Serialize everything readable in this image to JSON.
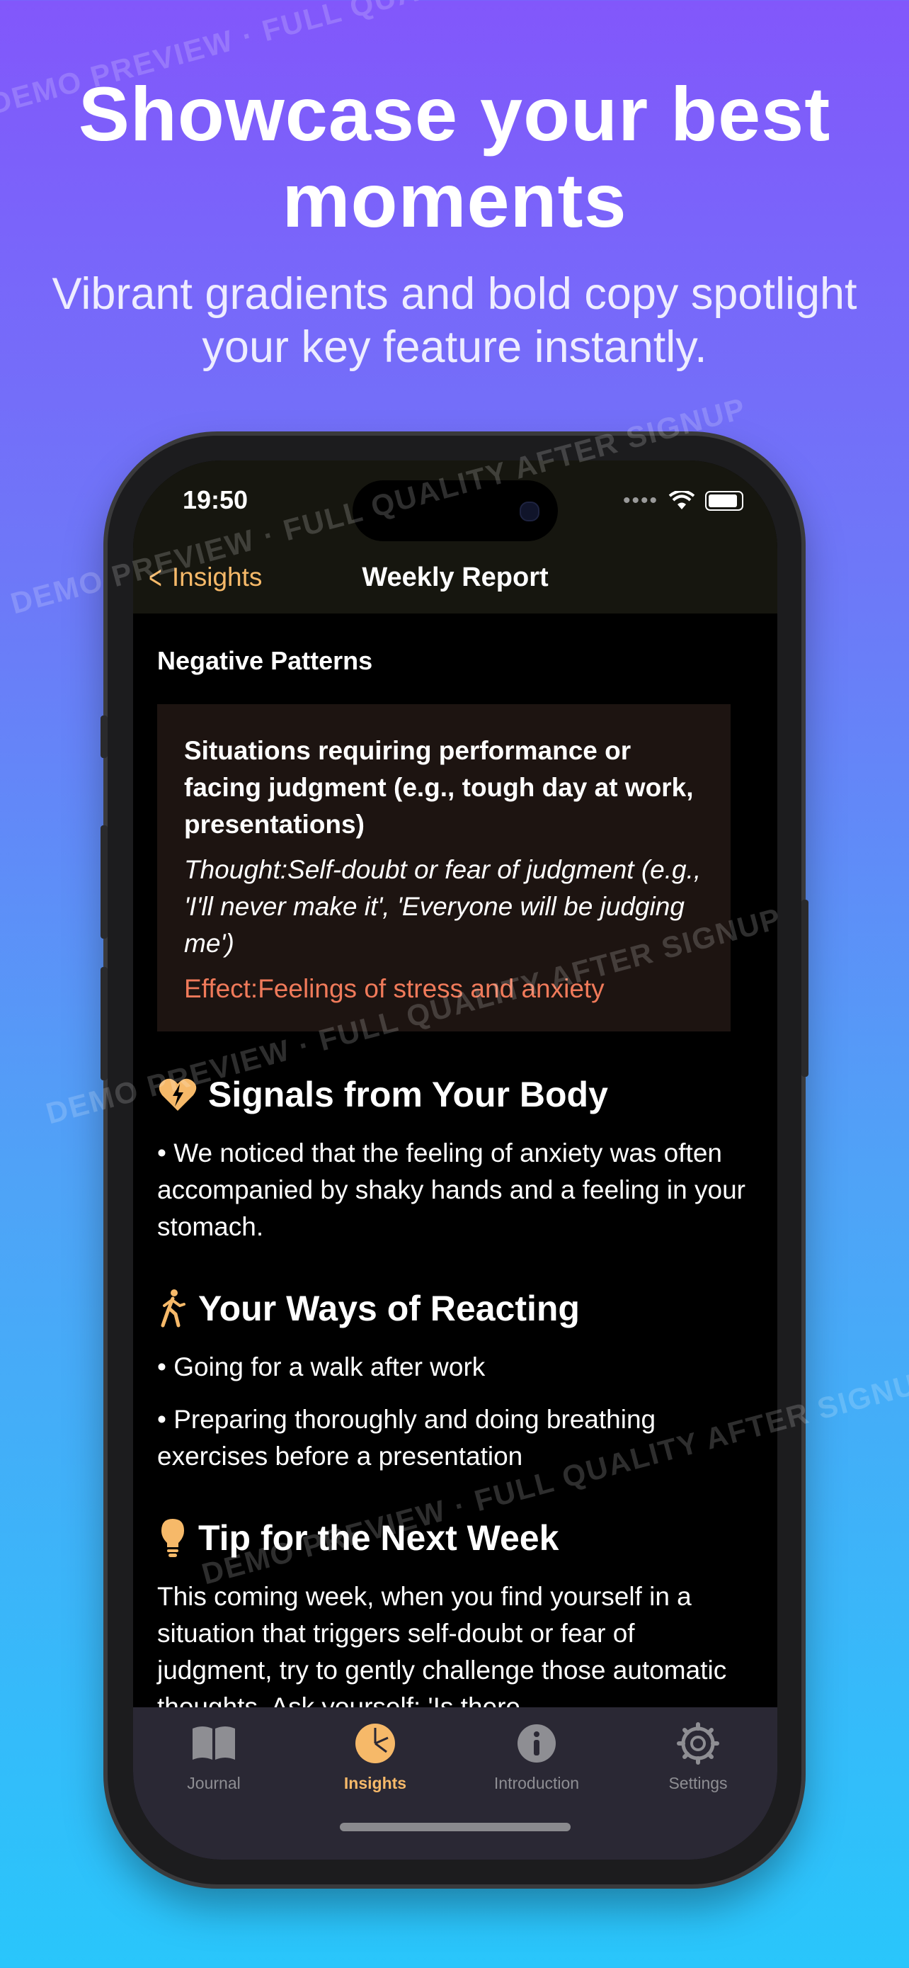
{
  "promo": {
    "headline": "Showcase your best moments",
    "subline": "Vibrant gradients and bold copy spotlight your key feature instantly."
  },
  "status_bar": {
    "time": "19:50"
  },
  "nav": {
    "back_label": "Insights",
    "title": "Weekly Report"
  },
  "negative_patterns": {
    "heading": "Negative Patterns",
    "situation": "Situations requiring performance or facing judgment (e.g., tough day at work, presentations)",
    "thought": "Thought:Self-doubt or fear of judgment (e.g., 'I'll never make it', 'Everyone will be judging me')",
    "effect": "Effect:Feelings of stress and anxiety"
  },
  "body_signals": {
    "heading": "Signals from Your Body",
    "text": "• We noticed that the feeling of anxiety was often accompanied by shaky hands and a feeling in your stomach."
  },
  "reacting": {
    "heading": "Your Ways of Reacting",
    "items": [
      "• Going for a walk after work",
      "• Preparing thoroughly and doing breathing exercises before a presentation"
    ]
  },
  "tip": {
    "heading": "Tip for the Next Week",
    "text": "This coming week, when you find yourself in a situation that triggers self-doubt or fear of judgment, try to gently challenge those automatic thoughts. Ask yourself: 'Is there"
  },
  "tabs": [
    {
      "label": "Journal",
      "icon": "book-icon"
    },
    {
      "label": "Insights",
      "icon": "pie-chart-icon"
    },
    {
      "label": "Introduction",
      "icon": "info-icon"
    },
    {
      "label": "Settings",
      "icon": "gear-icon"
    }
  ],
  "watermark": "DEMO PREVIEW · FULL QUALITY AFTER SIGNUP",
  "colors": {
    "accent": "#f6b969",
    "effect": "#f07a5a",
    "card_bg": "#1d1411"
  }
}
